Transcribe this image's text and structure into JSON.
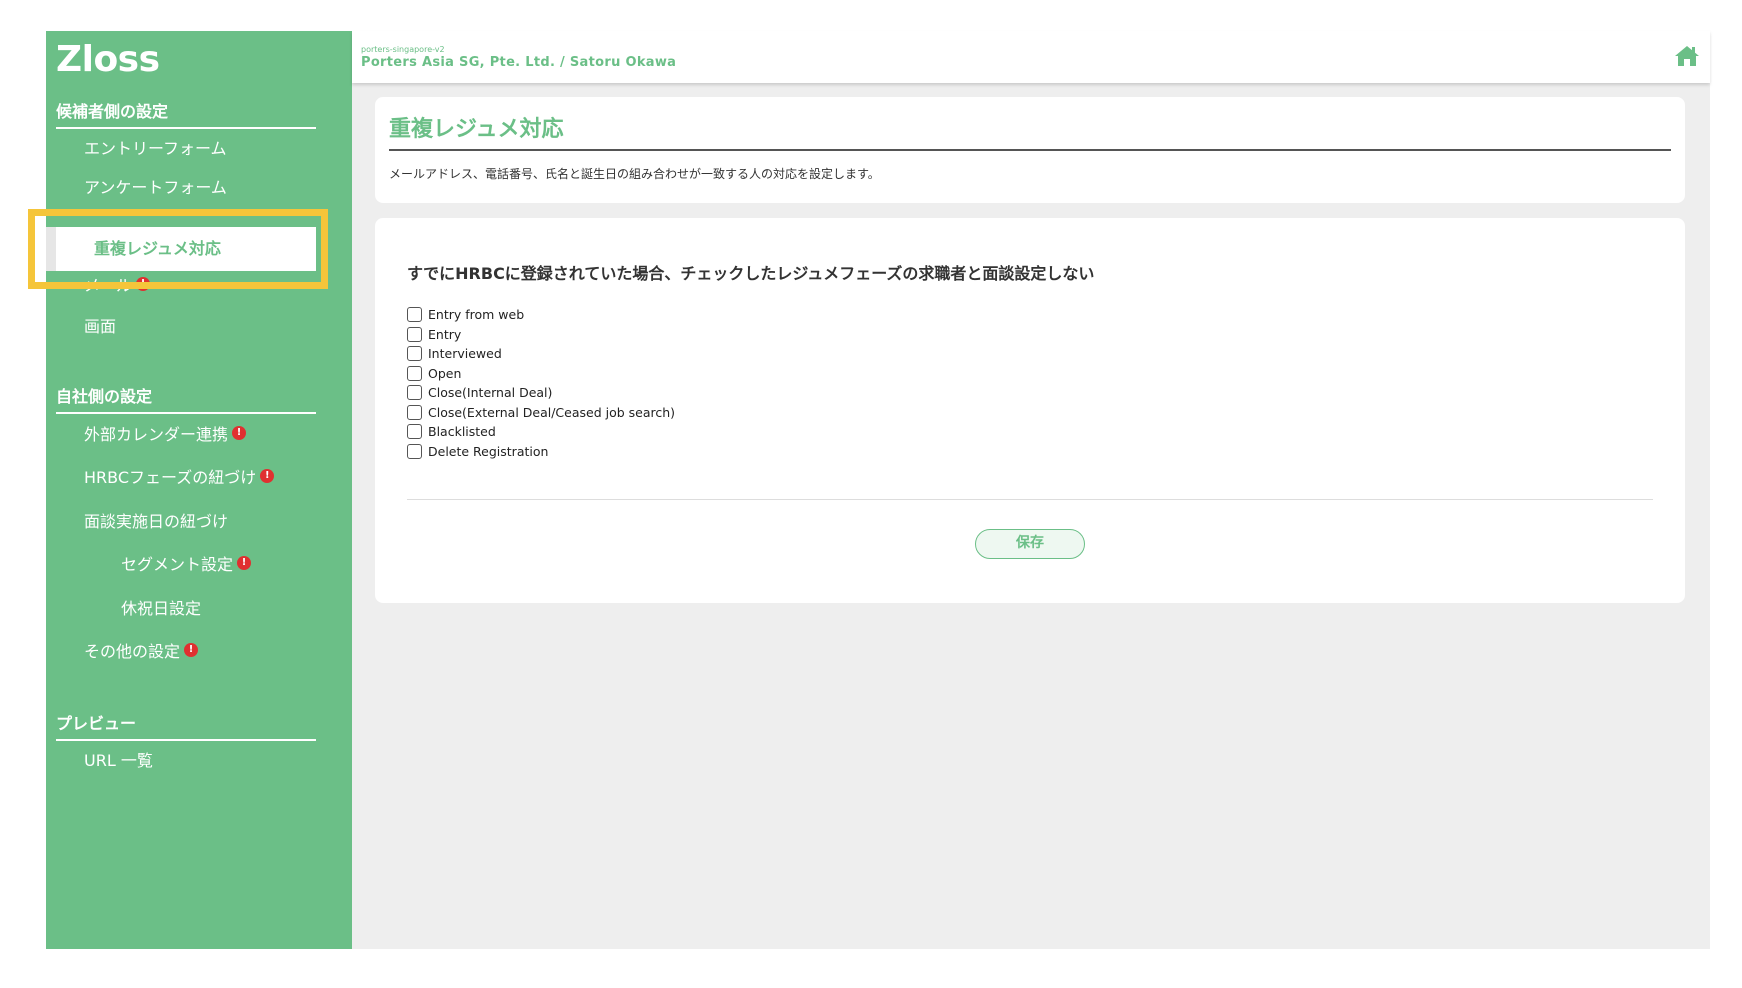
{
  "app": {
    "logo": "Zloss"
  },
  "header": {
    "tenant": "porters-singapore-v2",
    "company": "Porters Asia SG, Pte. Ltd. / Satoru Okawa",
    "home_icon": "home-icon"
  },
  "sidebar": {
    "section_candidate": "候補者側の設定",
    "items_candidate": [
      {
        "label": "エントリーフォーム"
      },
      {
        "label": "アンケートフォーム"
      },
      {
        "label": "重複レジュメ対応",
        "active": true
      },
      {
        "label": "メール",
        "badge": "!"
      },
      {
        "label": "画面"
      }
    ],
    "section_company": "自社側の設定",
    "items_company": [
      {
        "label": "外部カレンダー連携",
        "badge": "!"
      },
      {
        "label": "HRBCフェーズの紐づけ",
        "badge": "!"
      },
      {
        "label": "面談実施日の紐づけ"
      },
      {
        "label": "セグメント設定",
        "badge": "!"
      },
      {
        "label": "休祝日設定"
      },
      {
        "label": "その他の設定",
        "badge": "!"
      }
    ],
    "section_preview": "プレビュー",
    "items_preview": [
      {
        "label": "URL 一覧"
      }
    ]
  },
  "main": {
    "title": "重複レジュメ対応",
    "description": "メールアドレス、電話番号、氏名と誕生日の組み合わせが一致する人の対応を設定します。",
    "question": "すでにHRBCに登録されていた場合、チェックしたレジュメフェーズの求職者と面談設定しない",
    "options": [
      "Entry from web",
      "Entry",
      "Interviewed",
      "Open",
      "Close(Internal Deal)",
      "Close(External Deal/Ceased job search)",
      "Blacklisted",
      "Delete Registration"
    ],
    "save_label": "保存"
  },
  "colors": {
    "brand": "#6bbf87",
    "highlight": "#f5c53a",
    "badge": "#e03030"
  }
}
